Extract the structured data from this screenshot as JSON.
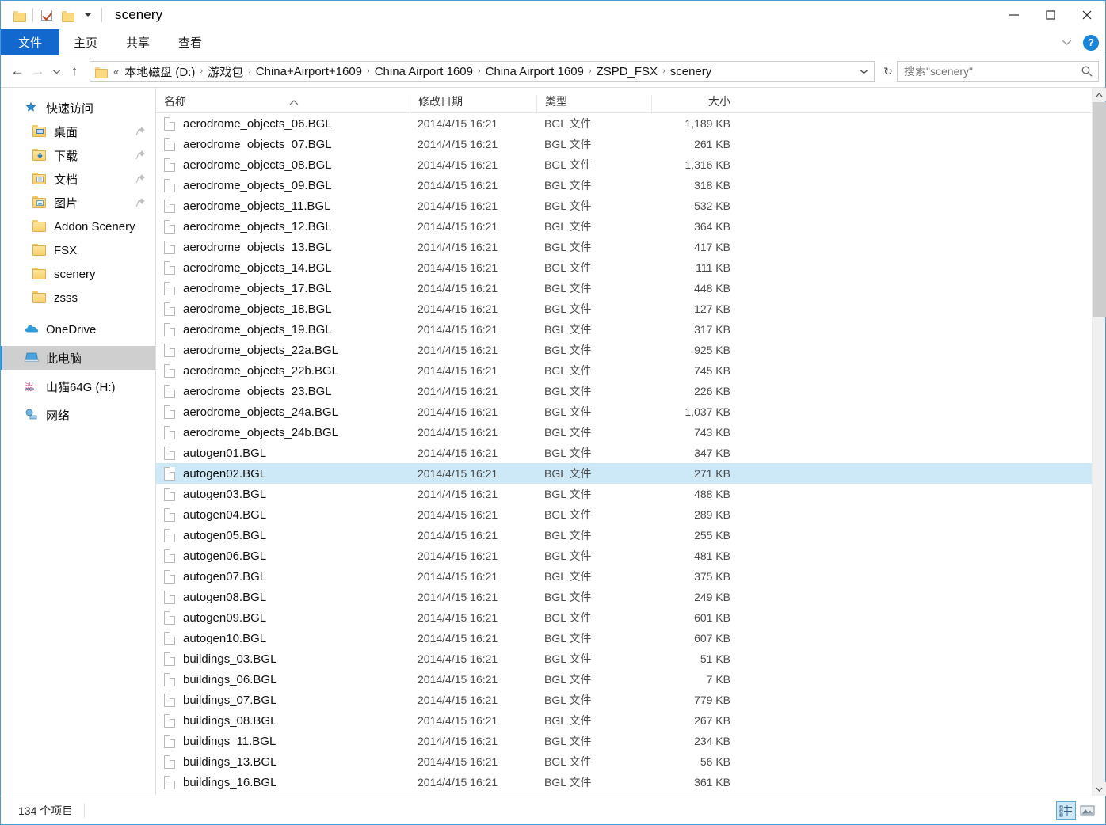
{
  "window": {
    "title": "scenery",
    "quick_access_toolbar": [
      {
        "name": "folder-icon",
        "label": "folder"
      },
      {
        "name": "properties-icon",
        "label": "properties"
      },
      {
        "name": "new-folder-icon",
        "label": "new folder"
      },
      {
        "name": "customize-caret-icon",
        "label": "customize"
      }
    ],
    "controls": {
      "minimize": "minimize",
      "maximize": "maximize",
      "close": "close"
    }
  },
  "ribbon": {
    "tabs": [
      {
        "label": "文件",
        "active": true
      },
      {
        "label": "主页",
        "active": false
      },
      {
        "label": "共享",
        "active": false
      },
      {
        "label": "查看",
        "active": false
      }
    ],
    "expand_label": "v",
    "help_label": "?"
  },
  "address": {
    "back": "←",
    "forward": "→",
    "recent": "v",
    "up": "↑",
    "overflow": "«",
    "crumbs": [
      "本地磁盘 (D:)",
      "游戏包",
      "China+Airport+1609",
      "China Airport 1609",
      "China Airport 1609",
      "ZSPD_FSX",
      "scenery"
    ],
    "separator": "›",
    "dropdown": "v",
    "refresh": "↻"
  },
  "search": {
    "value": "搜索\"scenery\"",
    "placeholder": "搜索\"scenery\"",
    "icon": "search-icon"
  },
  "sidebar": {
    "items": [
      {
        "label": "快速访问",
        "icon": "star-pin-icon",
        "level": 1,
        "pinned": false,
        "selected": false
      },
      {
        "label": "桌面",
        "icon": "desktop-folder-icon",
        "level": 2,
        "pinned": true,
        "selected": false
      },
      {
        "label": "下载",
        "icon": "downloads-folder-icon",
        "level": 2,
        "pinned": true,
        "selected": false
      },
      {
        "label": "文档",
        "icon": "documents-folder-icon",
        "level": 2,
        "pinned": true,
        "selected": false
      },
      {
        "label": "图片",
        "icon": "pictures-folder-icon",
        "level": 2,
        "pinned": true,
        "selected": false
      },
      {
        "label": "Addon Scenery",
        "icon": "folder-icon",
        "level": 2,
        "pinned": false,
        "selected": false
      },
      {
        "label": "FSX",
        "icon": "folder-icon",
        "level": 2,
        "pinned": false,
        "selected": false
      },
      {
        "label": "scenery",
        "icon": "folder-icon",
        "level": 2,
        "pinned": false,
        "selected": false
      },
      {
        "label": "zsss",
        "icon": "folder-icon",
        "level": 2,
        "pinned": false,
        "selected": false
      },
      {
        "label": "OneDrive",
        "icon": "onedrive-cloud-icon",
        "level": 1,
        "pinned": false,
        "selected": false
      },
      {
        "label": "此电脑",
        "icon": "this-pc-icon",
        "level": 1,
        "pinned": false,
        "selected": true
      },
      {
        "label": "山猫64G (H:)",
        "icon": "sdxc-drive-icon",
        "level": 1,
        "pinned": false,
        "selected": false
      },
      {
        "label": "网络",
        "icon": "network-icon",
        "level": 1,
        "pinned": false,
        "selected": false
      }
    ]
  },
  "columns": [
    {
      "key": "name",
      "label": "名称",
      "sorted": true,
      "sort_dir": "asc"
    },
    {
      "key": "date",
      "label": "修改日期"
    },
    {
      "key": "type",
      "label": "类型"
    },
    {
      "key": "size",
      "label": "大小"
    }
  ],
  "files": [
    {
      "name": "aerodrome_objects_06.BGL",
      "date": "2014/4/15 16:21",
      "type": "BGL 文件",
      "size": "1,189 KB",
      "selected": false
    },
    {
      "name": "aerodrome_objects_07.BGL",
      "date": "2014/4/15 16:21",
      "type": "BGL 文件",
      "size": "261 KB",
      "selected": false
    },
    {
      "name": "aerodrome_objects_08.BGL",
      "date": "2014/4/15 16:21",
      "type": "BGL 文件",
      "size": "1,316 KB",
      "selected": false
    },
    {
      "name": "aerodrome_objects_09.BGL",
      "date": "2014/4/15 16:21",
      "type": "BGL 文件",
      "size": "318 KB",
      "selected": false
    },
    {
      "name": "aerodrome_objects_11.BGL",
      "date": "2014/4/15 16:21",
      "type": "BGL 文件",
      "size": "532 KB",
      "selected": false
    },
    {
      "name": "aerodrome_objects_12.BGL",
      "date": "2014/4/15 16:21",
      "type": "BGL 文件",
      "size": "364 KB",
      "selected": false
    },
    {
      "name": "aerodrome_objects_13.BGL",
      "date": "2014/4/15 16:21",
      "type": "BGL 文件",
      "size": "417 KB",
      "selected": false
    },
    {
      "name": "aerodrome_objects_14.BGL",
      "date": "2014/4/15 16:21",
      "type": "BGL 文件",
      "size": "111 KB",
      "selected": false
    },
    {
      "name": "aerodrome_objects_17.BGL",
      "date": "2014/4/15 16:21",
      "type": "BGL 文件",
      "size": "448 KB",
      "selected": false
    },
    {
      "name": "aerodrome_objects_18.BGL",
      "date": "2014/4/15 16:21",
      "type": "BGL 文件",
      "size": "127 KB",
      "selected": false
    },
    {
      "name": "aerodrome_objects_19.BGL",
      "date": "2014/4/15 16:21",
      "type": "BGL 文件",
      "size": "317 KB",
      "selected": false
    },
    {
      "name": "aerodrome_objects_22a.BGL",
      "date": "2014/4/15 16:21",
      "type": "BGL 文件",
      "size": "925 KB",
      "selected": false
    },
    {
      "name": "aerodrome_objects_22b.BGL",
      "date": "2014/4/15 16:21",
      "type": "BGL 文件",
      "size": "745 KB",
      "selected": false
    },
    {
      "name": "aerodrome_objects_23.BGL",
      "date": "2014/4/15 16:21",
      "type": "BGL 文件",
      "size": "226 KB",
      "selected": false
    },
    {
      "name": "aerodrome_objects_24a.BGL",
      "date": "2014/4/15 16:21",
      "type": "BGL 文件",
      "size": "1,037 KB",
      "selected": false
    },
    {
      "name": "aerodrome_objects_24b.BGL",
      "date": "2014/4/15 16:21",
      "type": "BGL 文件",
      "size": "743 KB",
      "selected": false
    },
    {
      "name": "autogen01.BGL",
      "date": "2014/4/15 16:21",
      "type": "BGL 文件",
      "size": "347 KB",
      "selected": false
    },
    {
      "name": "autogen02.BGL",
      "date": "2014/4/15 16:21",
      "type": "BGL 文件",
      "size": "271 KB",
      "selected": true
    },
    {
      "name": "autogen03.BGL",
      "date": "2014/4/15 16:21",
      "type": "BGL 文件",
      "size": "488 KB",
      "selected": false
    },
    {
      "name": "autogen04.BGL",
      "date": "2014/4/15 16:21",
      "type": "BGL 文件",
      "size": "289 KB",
      "selected": false
    },
    {
      "name": "autogen05.BGL",
      "date": "2014/4/15 16:21",
      "type": "BGL 文件",
      "size": "255 KB",
      "selected": false
    },
    {
      "name": "autogen06.BGL",
      "date": "2014/4/15 16:21",
      "type": "BGL 文件",
      "size": "481 KB",
      "selected": false
    },
    {
      "name": "autogen07.BGL",
      "date": "2014/4/15 16:21",
      "type": "BGL 文件",
      "size": "375 KB",
      "selected": false
    },
    {
      "name": "autogen08.BGL",
      "date": "2014/4/15 16:21",
      "type": "BGL 文件",
      "size": "249 KB",
      "selected": false
    },
    {
      "name": "autogen09.BGL",
      "date": "2014/4/15 16:21",
      "type": "BGL 文件",
      "size": "601 KB",
      "selected": false
    },
    {
      "name": "autogen10.BGL",
      "date": "2014/4/15 16:21",
      "type": "BGL 文件",
      "size": "607 KB",
      "selected": false
    },
    {
      "name": "buildings_03.BGL",
      "date": "2014/4/15 16:21",
      "type": "BGL 文件",
      "size": "51 KB",
      "selected": false
    },
    {
      "name": "buildings_06.BGL",
      "date": "2014/4/15 16:21",
      "type": "BGL 文件",
      "size": "7 KB",
      "selected": false
    },
    {
      "name": "buildings_07.BGL",
      "date": "2014/4/15 16:21",
      "type": "BGL 文件",
      "size": "779 KB",
      "selected": false
    },
    {
      "name": "buildings_08.BGL",
      "date": "2014/4/15 16:21",
      "type": "BGL 文件",
      "size": "267 KB",
      "selected": false
    },
    {
      "name": "buildings_11.BGL",
      "date": "2014/4/15 16:21",
      "type": "BGL 文件",
      "size": "234 KB",
      "selected": false
    },
    {
      "name": "buildings_13.BGL",
      "date": "2014/4/15 16:21",
      "type": "BGL 文件",
      "size": "56 KB",
      "selected": false
    },
    {
      "name": "buildings_16.BGL",
      "date": "2014/4/15 16:21",
      "type": "BGL 文件",
      "size": "361 KB",
      "selected": false
    }
  ],
  "status": {
    "item_count": "134 个项目"
  },
  "view_buttons": [
    {
      "name": "details-view-button",
      "label": "详细信息",
      "active": true
    },
    {
      "name": "large-icons-view-button",
      "label": "大图标",
      "active": false
    }
  ],
  "colors": {
    "accent": "#1368ce",
    "selection": "#cde8f7",
    "nav_selection": "#cfcfcf",
    "window_border": "#4a9ad4",
    "folder": "#fbd97f"
  }
}
